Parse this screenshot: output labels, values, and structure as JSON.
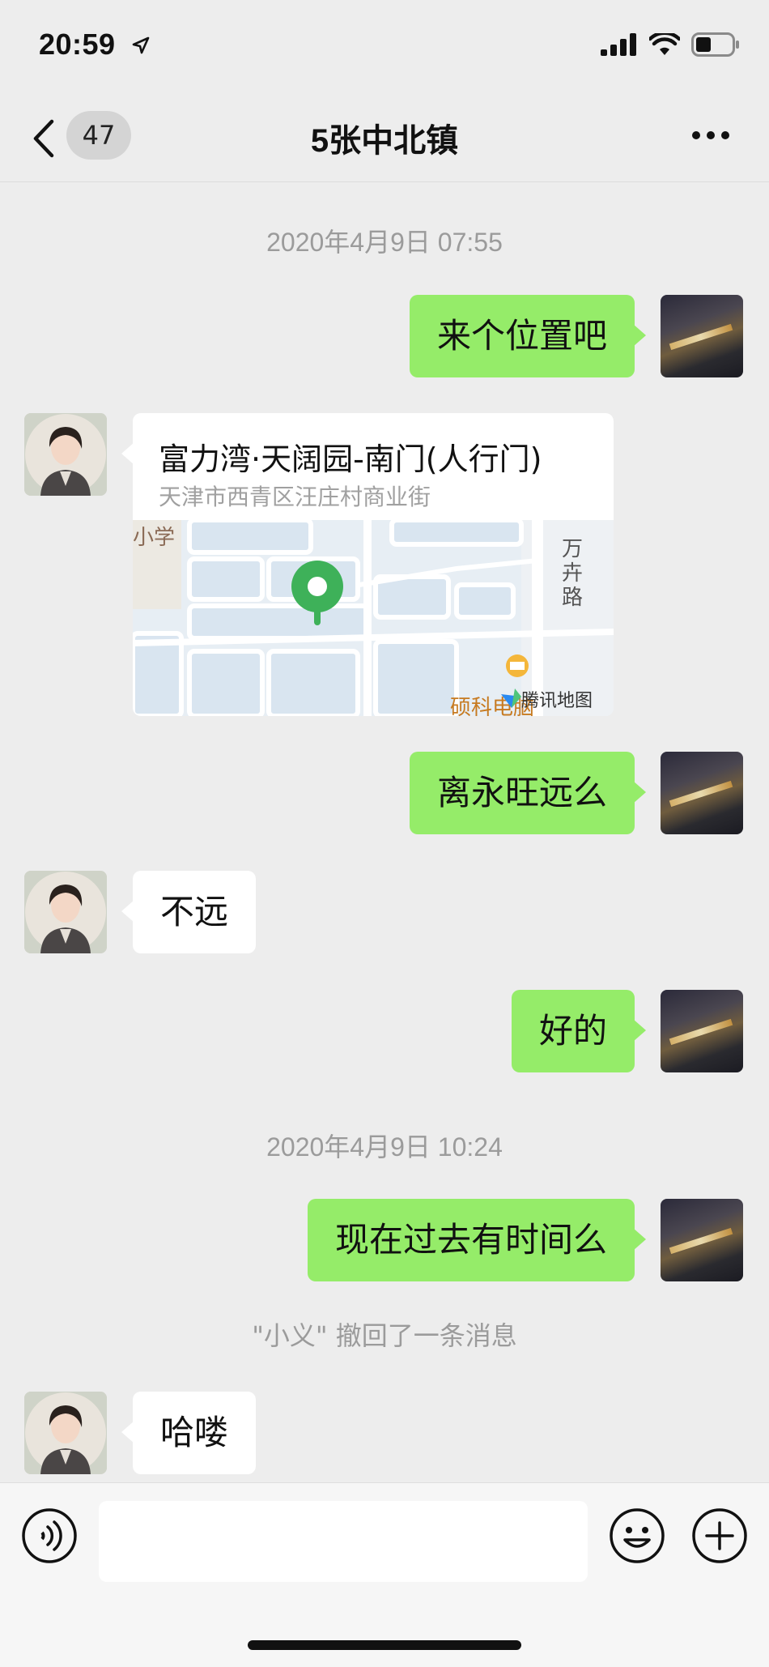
{
  "status": {
    "time": "20:59"
  },
  "nav": {
    "unread_count": "47",
    "title": "5张中北镇"
  },
  "chat": {
    "timestamp1": "2020年4月9日 07:55",
    "msg1": "来个位置吧",
    "location": {
      "title": "富力湾·天阔园-南门(人行门)",
      "address": "天津市西青区汪庄村商业街",
      "map_label_school": "小学",
      "map_label_road": "万\n卉\n路",
      "map_label_shop": "硕科电脑",
      "map_provider": "腾讯地图"
    },
    "msg2": "离永旺远么",
    "msg3": "不远",
    "msg4": "好的",
    "timestamp2": "2020年4月9日 10:24",
    "msg5": "现在过去有时间么",
    "recall_notice": "\"小义\" 撤回了一条消息",
    "msg6": "哈喽"
  }
}
